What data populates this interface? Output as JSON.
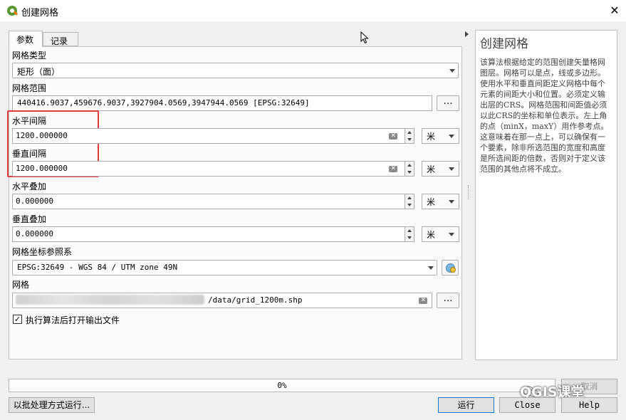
{
  "window": {
    "title": "创建网格",
    "close_symbol": "✕"
  },
  "tabs": [
    {
      "label": "参数"
    },
    {
      "label": "记录"
    }
  ],
  "params": {
    "grid_type": {
      "label": "网格类型",
      "value": "矩形（面）"
    },
    "grid_extent": {
      "label": "网格范围",
      "value": "440416.9037,459676.9037,3927904.0569,3947944.0569 [EPSG:32649]",
      "button": "…"
    },
    "h_spacing": {
      "label": "水平间隔",
      "value": "1200.000000",
      "unit": "米"
    },
    "v_spacing": {
      "label": "垂直间隔",
      "value": "1200.000000",
      "unit": "米"
    },
    "h_overlay": {
      "label": "水平叠加",
      "value": "0.000000",
      "unit": "米"
    },
    "v_overlay": {
      "label": "垂直叠加",
      "value": "0.000000",
      "unit": "米"
    },
    "crs": {
      "label": "网格坐标参照系",
      "value": "EPSG:32649 - WGS 84 / UTM zone 49N"
    },
    "output": {
      "label": "网格",
      "value_suffix": "/data/grid_1200m.shp",
      "button": "…"
    },
    "open_output": {
      "label": "执行算法后打开输出文件",
      "checked": true,
      "check_mark": "✓"
    }
  },
  "help": {
    "title": "创建网格",
    "text": "该算法根据给定的范围创建矢量格网图层。网格可以是点，线或多边形。使用水平和垂直间距定义网格中每个元素的间距大小和位置。必须定义输出层的CRS。网格范围和间距值必须以此CRS的坐标和单位表示。左上角的点（minX，maxY）用作参考点。这意味着在那一点上，可以确保有一个要素，除非所选范围的宽度和高度是所选间距的倍数，否则对于定义该范围的其他点将不成立。"
  },
  "progress": {
    "value": 0,
    "label": "0%"
  },
  "buttons": {
    "batch": "以批处理方式运行...",
    "run": "运行",
    "close": "Close",
    "help": "Help",
    "cancel": "取消"
  },
  "watermark": "QGIS课堂",
  "colors": {
    "highlight": "#e23b3b",
    "focus": "#0078d7",
    "qgis_green": "#589632"
  }
}
